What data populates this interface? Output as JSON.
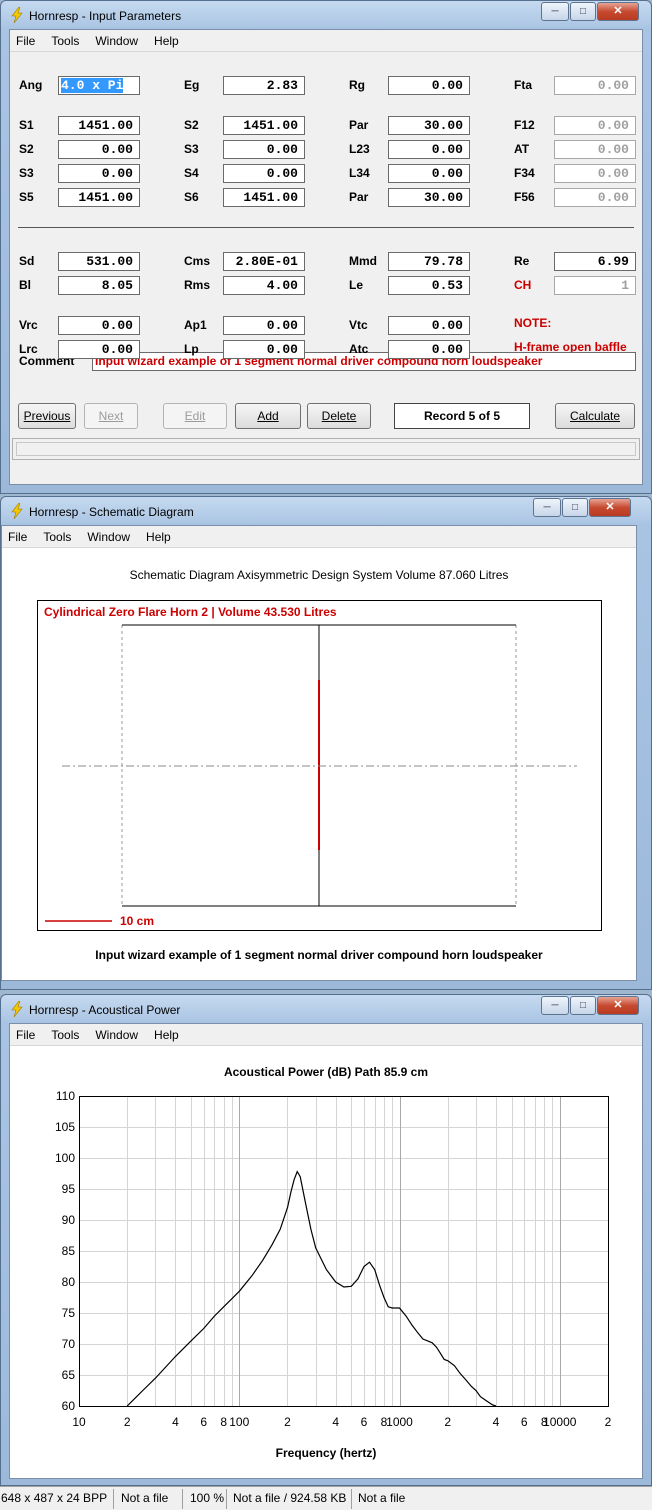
{
  "win1": {
    "title": "Hornresp - Input Parameters",
    "menu": [
      "File",
      "Tools",
      "Window",
      "Help"
    ],
    "rows": [
      [
        {
          "l": "Ang",
          "v": "4.0 x Pi"
        },
        {
          "l": "Eg",
          "v": "2.83"
        },
        {
          "l": "Rg",
          "v": "0.00"
        },
        {
          "l": "Fta",
          "v": "0.00"
        }
      ],
      [
        {
          "l": "S1",
          "v": "1451.00"
        },
        {
          "l": "S2",
          "v": "1451.00"
        },
        {
          "l": "Par",
          "v": "30.00"
        },
        {
          "l": "F12",
          "v": "0.00"
        }
      ],
      [
        {
          "l": "S2",
          "v": "0.00"
        },
        {
          "l": "S3",
          "v": "0.00"
        },
        {
          "l": "L23",
          "v": "0.00"
        },
        {
          "l": "AT",
          "v": "0.00"
        }
      ],
      [
        {
          "l": "S3",
          "v": "0.00"
        },
        {
          "l": "S4",
          "v": "0.00"
        },
        {
          "l": "L34",
          "v": "0.00"
        },
        {
          "l": "F34",
          "v": "0.00"
        }
      ],
      [
        {
          "l": "S5",
          "v": "1451.00"
        },
        {
          "l": "S6",
          "v": "1451.00"
        },
        {
          "l": "Par",
          "v": "30.00"
        },
        {
          "l": "F56",
          "v": "0.00"
        }
      ],
      [
        {
          "l": "Sd",
          "v": "531.00"
        },
        {
          "l": "Cms",
          "v": "2.80E-01"
        },
        {
          "l": "Mmd",
          "v": "79.78"
        },
        {
          "l": "Re",
          "v": "6.99"
        }
      ],
      [
        {
          "l": "Bl",
          "v": "8.05"
        },
        {
          "l": "Rms",
          "v": "4.00"
        },
        {
          "l": "Le",
          "v": "0.53"
        },
        {
          "l": "CH",
          "v": "1"
        }
      ],
      [
        {
          "l": "Vrc",
          "v": "0.00"
        },
        {
          "l": "Ap1",
          "v": "0.00"
        },
        {
          "l": "Vtc",
          "v": "0.00"
        }
      ],
      [
        {
          "l": "Lrc",
          "v": "0.00"
        },
        {
          "l": "Lp",
          "v": "0.00"
        },
        {
          "l": "Atc",
          "v": "0.00"
        }
      ]
    ],
    "note_label": "NOTE:",
    "note_text": "H-frame open baffle",
    "comment_label": "Comment",
    "comment": "Input wizard example of 1 segment normal driver compound horn loudspeaker",
    "buttons": {
      "previous": "Previous",
      "next": "Next",
      "edit": "Edit",
      "add": "Add",
      "delete": "Delete",
      "calculate": "Calculate"
    },
    "record": "Record 5 of 5"
  },
  "win2": {
    "title": "Hornresp - Schematic Diagram",
    "menu": [
      "File",
      "Tools",
      "Window",
      "Help"
    ],
    "heading": "Schematic Diagram   Axisymmetric Design   System Volume 87.060 Litres",
    "horn_label": "Cylindrical Zero Flare Horn 2 | Volume 43.530 Litres",
    "scale_label": "10 cm",
    "caption": "Input wizard example of 1 segment normal driver compound horn loudspeaker",
    "accent": "#cc0000"
  },
  "win3": {
    "title": "Hornresp - Acoustical Power",
    "menu": [
      "File",
      "Tools",
      "Window",
      "Help"
    ]
  },
  "chart_data": {
    "type": "line",
    "title": "Acoustical Power (dB)   Path 85.9 cm",
    "xlabel": "Frequency (hertz)",
    "ylabel": "",
    "xscale": "log",
    "xlim": [
      10,
      20000
    ],
    "ylim": [
      60,
      110
    ],
    "grid": true,
    "ytick_labels": [
      "110",
      "105",
      "100",
      "95",
      "90",
      "85",
      "80",
      "75",
      "70",
      "65",
      "60"
    ],
    "xtick_labels": [
      {
        "f": 10,
        "t": "10"
      },
      {
        "f": 20,
        "t": "2"
      },
      {
        "f": 40,
        "t": "4"
      },
      {
        "f": 60,
        "t": "6"
      },
      {
        "f": 80,
        "t": "8"
      },
      {
        "f": 100,
        "t": "100"
      },
      {
        "f": 200,
        "t": "2"
      },
      {
        "f": 400,
        "t": "4"
      },
      {
        "f": 600,
        "t": "6"
      },
      {
        "f": 800,
        "t": "8"
      },
      {
        "f": 1000,
        "t": "1000"
      },
      {
        "f": 2000,
        "t": "2"
      },
      {
        "f": 4000,
        "t": "4"
      },
      {
        "f": 6000,
        "t": "6"
      },
      {
        "f": 8000,
        "t": "8"
      },
      {
        "f": 10000,
        "t": "10000"
      },
      {
        "f": 20000,
        "t": "2"
      }
    ],
    "series": [
      {
        "x": [
          20,
          25,
          30,
          40,
          50,
          60,
          70,
          80,
          90,
          100,
          120,
          140,
          160,
          180,
          200,
          210,
          220,
          230,
          240,
          260,
          280,
          300,
          350,
          400,
          450,
          500,
          550,
          600,
          650,
          700,
          750,
          800,
          850,
          900,
          1000,
          1100,
          1200,
          1300,
          1400,
          1500,
          1600,
          1700,
          1800,
          1900,
          2000,
          2200,
          2400,
          2600,
          2800,
          3000,
          3200,
          3500,
          3800,
          4000
        ],
        "y": [
          60,
          62.5,
          64.5,
          68,
          70.5,
          72.5,
          74.5,
          76,
          77.3,
          78.5,
          81,
          83.5,
          86,
          88.5,
          92,
          94.5,
          96.5,
          97.8,
          97,
          92.5,
          88.5,
          85.5,
          82,
          80,
          79.2,
          79.3,
          80.5,
          82.5,
          83.2,
          82,
          79.5,
          77.5,
          76,
          75.8,
          75.8,
          74.5,
          73,
          71.8,
          70.8,
          70.5,
          70.2,
          69.5,
          68.5,
          67.5,
          67.3,
          66.5,
          65.2,
          64.2,
          63.2,
          62.5,
          61.5,
          60.8,
          60.2,
          59.5
        ]
      }
    ]
  },
  "statusbar": {
    "image_info": "648 x 487 x 24 BPP",
    "file1": "Not a file",
    "zoom": "100 %",
    "file2": "Not a file / 924.58 KB",
    "file3": "Not a file"
  }
}
